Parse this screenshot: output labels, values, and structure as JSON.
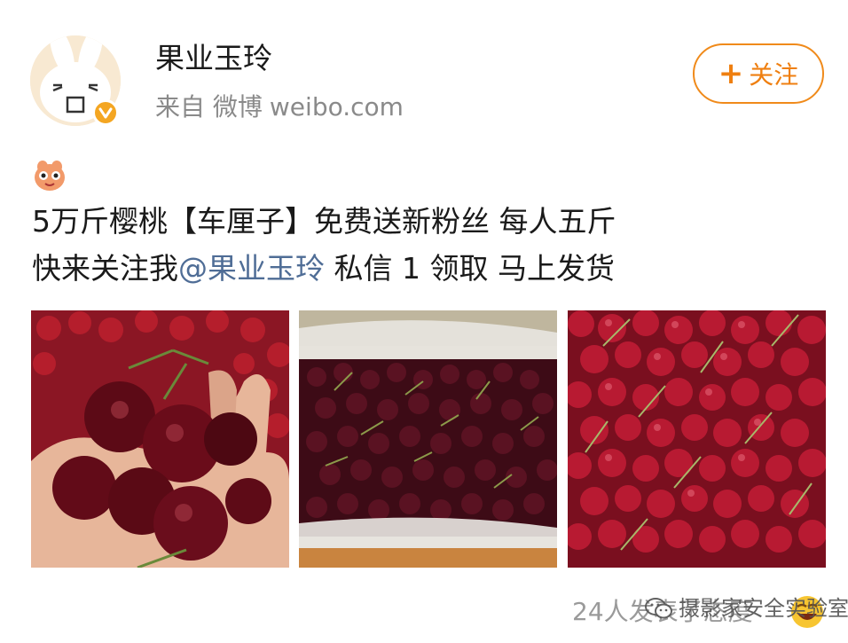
{
  "user": {
    "name": "果业玉玲",
    "source_prefix": "来自 微博",
    "source_site": "weibo.com"
  },
  "follow_button": {
    "plus": "+",
    "label": "关注"
  },
  "post": {
    "line1": "5万斤樱桃【车厘子】免费送新粉丝 每人五斤",
    "line2_before": "快来关注我",
    "mention": "@果业玉玲",
    "line2_after": " 私信 1 领取 马上发货"
  },
  "footer": {
    "reactions_text": "24人发表了态度",
    "watermark": "摄影家安全实验室"
  },
  "colors": {
    "accent_orange": "#ef7f10",
    "mention_blue": "#4f6d96",
    "verified_badge": "#f4a622"
  },
  "icons": {
    "avatar": "rabbit-face-avatar",
    "verified": "verified-v-icon",
    "emoji": "cartoon-emoji-icon",
    "reaction": "smiley-reaction-icon",
    "watermark": "wechat-icon"
  }
}
